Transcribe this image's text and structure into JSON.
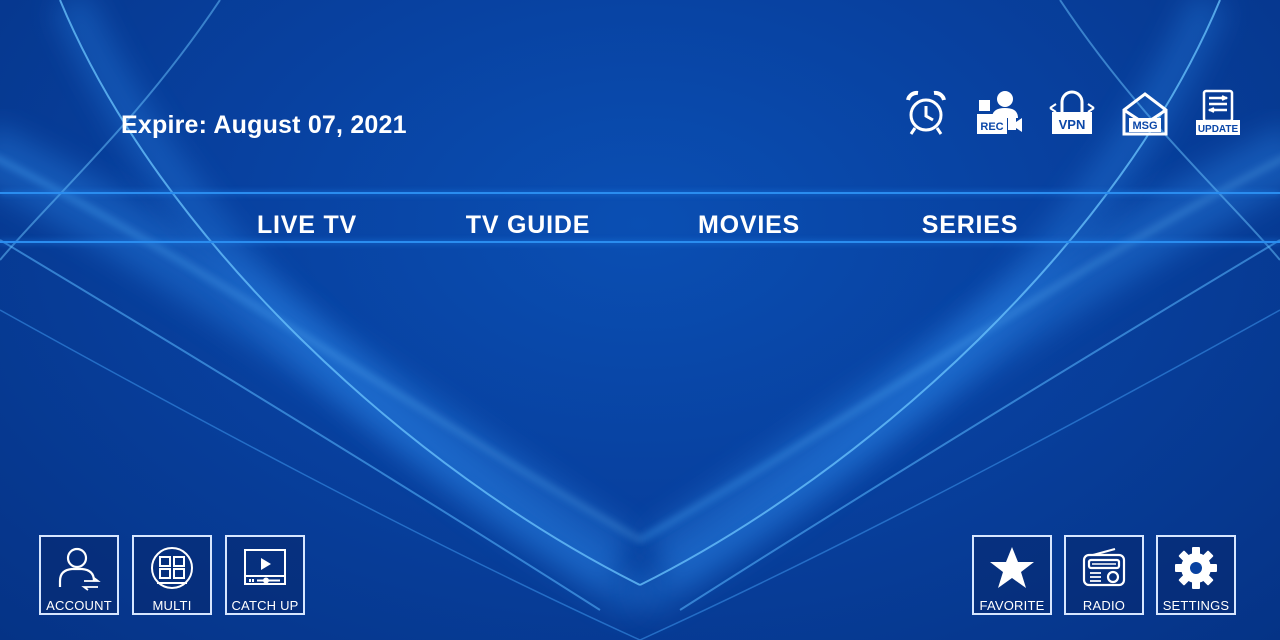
{
  "header": {
    "expire_text": "Expire: August 07, 2021"
  },
  "top_icons": [
    {
      "name": "alarm-icon",
      "label": ""
    },
    {
      "name": "record-icon",
      "label": "REC"
    },
    {
      "name": "vpn-icon",
      "label": "VPN"
    },
    {
      "name": "message-icon",
      "label": "MSG"
    },
    {
      "name": "update-icon",
      "label": "UPDATE"
    }
  ],
  "menu": {
    "items": [
      {
        "label": "LIVE TV"
      },
      {
        "label": "TV GUIDE"
      },
      {
        "label": "MOVIES"
      },
      {
        "label": "SERIES"
      }
    ]
  },
  "tiles_left": [
    {
      "label": "ACCOUNT",
      "icon": "account-icon"
    },
    {
      "label": "MULTI",
      "icon": "multiscreen-icon"
    },
    {
      "label": "CATCH UP",
      "icon": "catchup-icon"
    }
  ],
  "tiles_right": [
    {
      "label": "FAVORITE",
      "icon": "star-icon"
    },
    {
      "label": "RADIO",
      "icon": "radio-icon"
    },
    {
      "label": "SETTINGS",
      "icon": "gear-icon"
    }
  ],
  "colors": {
    "background": "#0841a0",
    "accent_line": "#2a8df0",
    "text": "#ffffff"
  }
}
